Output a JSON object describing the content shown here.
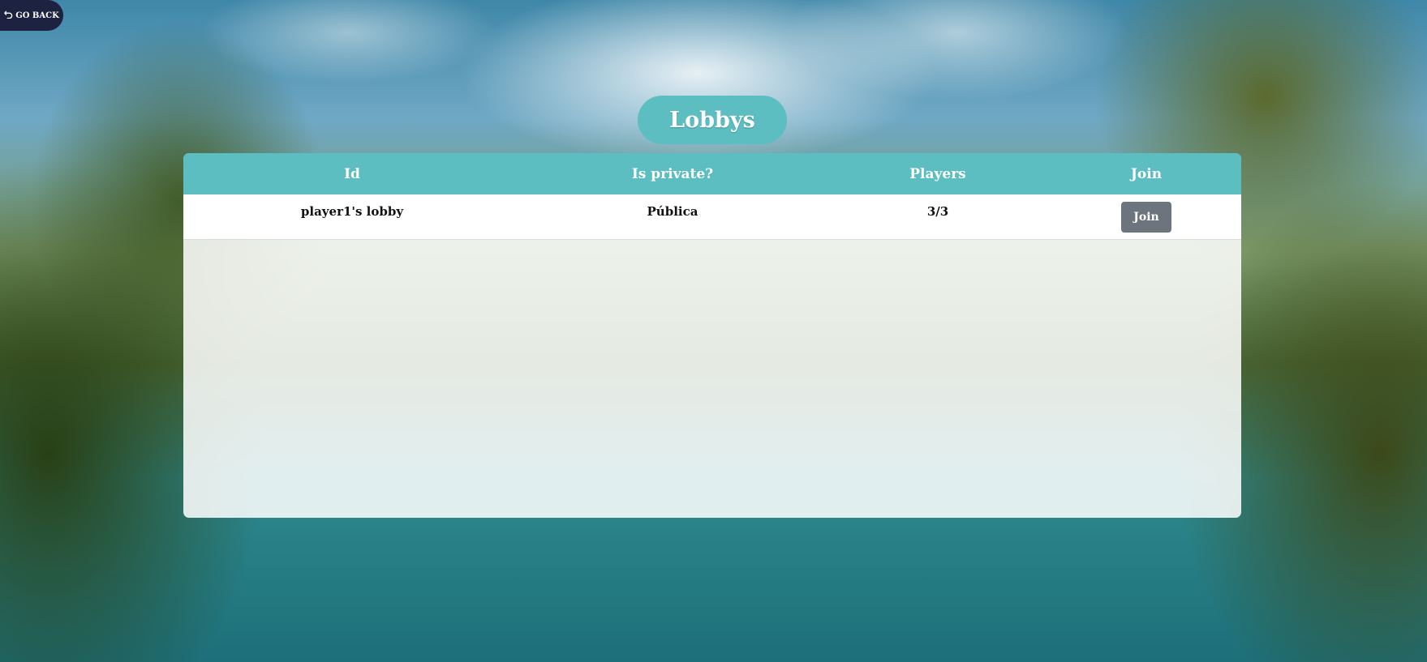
{
  "nav": {
    "go_back_label": "GO BACK",
    "go_back_icon": "undo-arrow-icon"
  },
  "page": {
    "title": "Lobbys"
  },
  "table": {
    "columns": [
      "Id",
      "Is private?",
      "Players",
      "Join"
    ],
    "rows": [
      {
        "id": "player1's lobby",
        "privacy": "Pública",
        "players": "3/3",
        "join_label": "Join"
      }
    ]
  },
  "colors": {
    "accent": "#5cbec0",
    "nav_bg": "#1d2240",
    "join_button": "#6c757d"
  }
}
